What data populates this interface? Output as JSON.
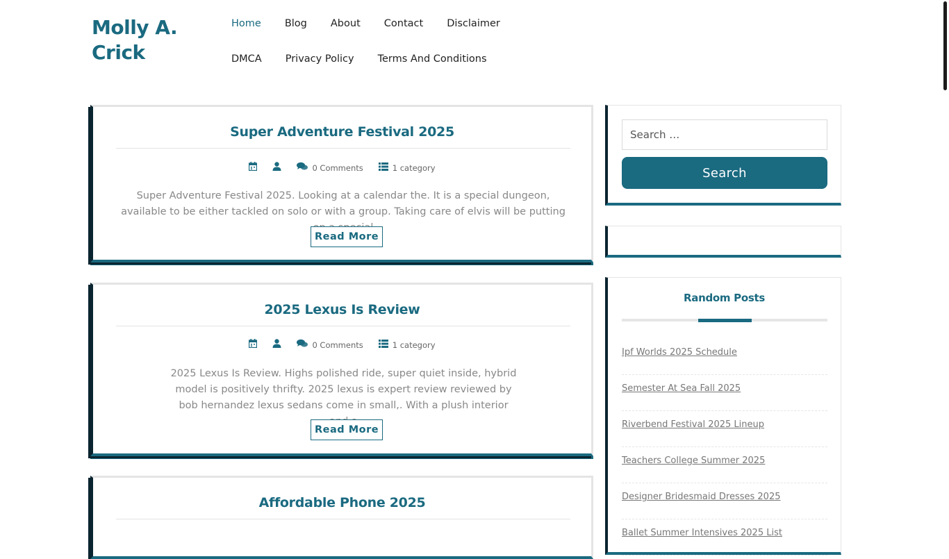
{
  "site": {
    "title": "Molly A. Crick"
  },
  "nav": {
    "items": [
      {
        "label": "Home",
        "active": true
      },
      {
        "label": "Blog"
      },
      {
        "label": "About"
      },
      {
        "label": "Contact"
      },
      {
        "label": "Disclaimer"
      },
      {
        "label": "DMCA"
      },
      {
        "label": "Privacy Policy"
      },
      {
        "label": "Terms And Conditions"
      }
    ]
  },
  "posts": [
    {
      "title": "Super Adventure Festival 2025",
      "comments": "0 Comments",
      "category": "1 category",
      "excerpt": "Super Adventure Festival 2025. Looking at a calendar the. It is a special dungeon, available to be either tackled on solo or with a group. Taking care of elvis will be putting on a special",
      "read_more": "Read More"
    },
    {
      "title": "2025 Lexus Is Review",
      "comments": "0 Comments",
      "category": "1 category",
      "excerpt": "2025 Lexus Is Review. Highs polished ride, super quiet inside, hybrid model is positively thrifty. 2025 lexus is expert review reviewed by bob hernandez lexus sedans come in small,. With a plush interior and a",
      "read_more": "Read More"
    },
    {
      "title": "Affordable Phone 2025"
    }
  ],
  "sidebar": {
    "search": {
      "placeholder": "Search …",
      "button": "Search"
    },
    "random_posts": {
      "title": "Random Posts",
      "items": [
        "Ipf Worlds 2025 Schedule",
        "Semester At Sea Fall 2025",
        "Riverbend Festival 2025 Lineup",
        "Teachers College Summer 2025",
        "Designer Bridesmaid Dresses 2025",
        "Ballet Summer Intensives 2025 List"
      ]
    }
  },
  "icons": {
    "calendar": "calendar-icon",
    "author": "user-icon",
    "comments": "comments-icon",
    "category": "list-icon"
  },
  "colors": {
    "accent": "#1a6a80",
    "dark": "#0b2530"
  }
}
